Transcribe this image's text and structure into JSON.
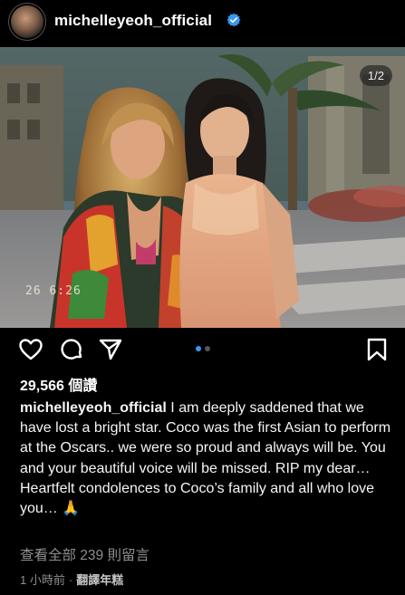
{
  "post": {
    "username": "michelleyeoh_official",
    "verified_icon": "verified-badge-icon",
    "image_counter": "1/2",
    "photo_timestamp": "26  6:26",
    "views": "29,566 個讚",
    "caption": "I am deeply saddened that we have lost a bright star. Coco was the first Asian to perform at the Oscars.. we were so proud and always will be. You and your beautiful voice will be missed. RIP my dear… Heartfelt condolences to Coco’s family and all who love you… 🙏",
    "view_comments": "查看全部 239 則留言",
    "time_ago": "1 小時前",
    "separator": "·",
    "translate": "翻譯年糕"
  },
  "carousel": {
    "count": 2,
    "active": 1
  },
  "colors": {
    "background": "#000000",
    "accent": "#3897f0",
    "muted": "#8e8e8e"
  }
}
